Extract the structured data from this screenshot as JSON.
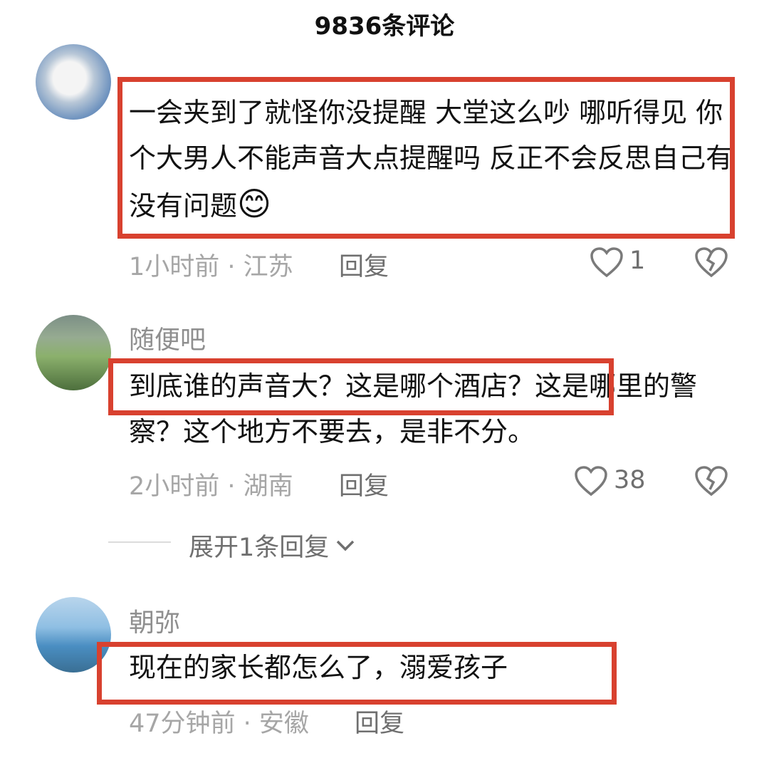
{
  "header": {
    "title": "9836条评论"
  },
  "comments": [
    {
      "content": "一会夹到了就怪你没提醒  大堂这么吵 哪听得见 你个大男人不能声音大点提醒吗     反正不会反思自己有没有问题",
      "emoji": "😊",
      "meta": "1小时前 · 江苏",
      "reply_label": "回复",
      "like_count": "1"
    },
    {
      "name": "随便吧",
      "content": "到底谁的声音大？这是哪个酒店？这是哪里的警察？这个地方不要去，是非不分。",
      "meta": "2小时前 · 湖南",
      "reply_label": "回复",
      "like_count": "38",
      "expand_label": "展开1条回复"
    },
    {
      "name": "朝弥",
      "content": "现在的家长都怎么了，溺爱孩子",
      "meta": "47分钟前 · 安徽",
      "reply_label": "回复"
    }
  ],
  "icons": {
    "like": "heart-outline-icon",
    "dislike": "broken-heart-icon",
    "expand": "chevron-down-icon"
  },
  "colors": {
    "highlight_box": "#d8412f",
    "meta_text": "#a6a6a6"
  }
}
